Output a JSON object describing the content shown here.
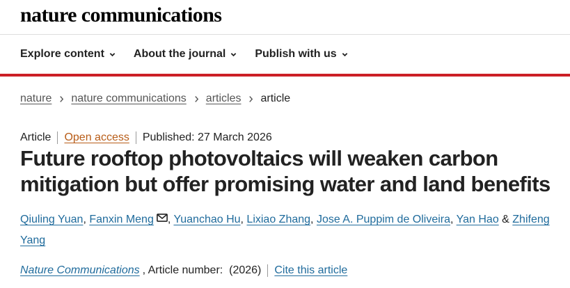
{
  "site": {
    "logo": "nature communications"
  },
  "nav": {
    "items": [
      {
        "label": "Explore content"
      },
      {
        "label": "About the journal"
      },
      {
        "label": "Publish with us"
      }
    ]
  },
  "breadcrumb": {
    "items": [
      "nature",
      "nature communications",
      "articles"
    ],
    "current": "article"
  },
  "article": {
    "type": "Article",
    "access": "Open access",
    "published": "Published: 27 March 2026",
    "title": "Future rooftop photovoltaics will weaken carbon mitigation but offer promising water and land benefits",
    "authors": [
      "Qiuling Yuan",
      "Fanxin Meng",
      "Yuanchao Hu",
      "Lixiao Zhang",
      "Jose A. Puppim de Oliveira",
      "Yan Hao",
      "Zhifeng Yang"
    ],
    "author_sep": ", ",
    "author_last_sep": " & ",
    "journal": "Nature Communications",
    "article_number": ", Article number:  (2026)",
    "cite_label": "Cite this article"
  },
  "colors": {
    "accent_red": "#cc1f26",
    "link_blue": "#1f6b9c",
    "open_access": "#b85c17"
  },
  "icons": {
    "nav_chevron": "chevron-down-icon",
    "breadcrumb_separator": "chevron-right-icon",
    "corresponding_author": "mail-icon"
  }
}
